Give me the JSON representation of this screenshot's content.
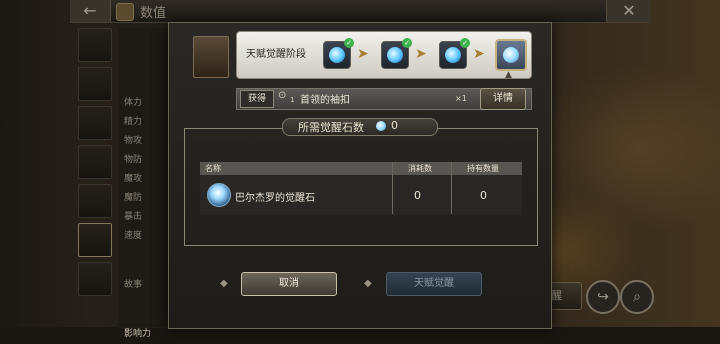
{
  "header": {
    "title": "数值",
    "back_icon": "arrow-left-icon",
    "close_icon": "close-icon"
  },
  "sidebar": {
    "stats": [
      "体力",
      "精力",
      "物攻",
      "物防",
      "魔攻",
      "魔防",
      "暴击",
      "速度"
    ],
    "sections": [
      "故事",
      "影响力"
    ]
  },
  "background_actions": {
    "awaken_label": "觉醒"
  },
  "dialog": {
    "stage_label": "天赋觉醒阶段",
    "stages_cleared": 3,
    "reward": {
      "get_label": "获得",
      "small_count": "1",
      "name": "首领的袖扣",
      "qty": "×1"
    },
    "details_label": "详情",
    "requirement": {
      "label": "所需觉醒石数",
      "count": "0"
    },
    "table": {
      "headers": [
        "名称",
        "消耗数",
        "持有数量"
      ],
      "rows": [
        {
          "name": "巴尔杰罗的觉醒石",
          "consume": "0",
          "owned": "0"
        }
      ]
    },
    "cancel_label": "取消",
    "awaken_label": "天赋觉醒"
  },
  "colors": {
    "stage_orb": "#56c3ff",
    "check": "#3fb24e",
    "arrow": "#a78033"
  }
}
